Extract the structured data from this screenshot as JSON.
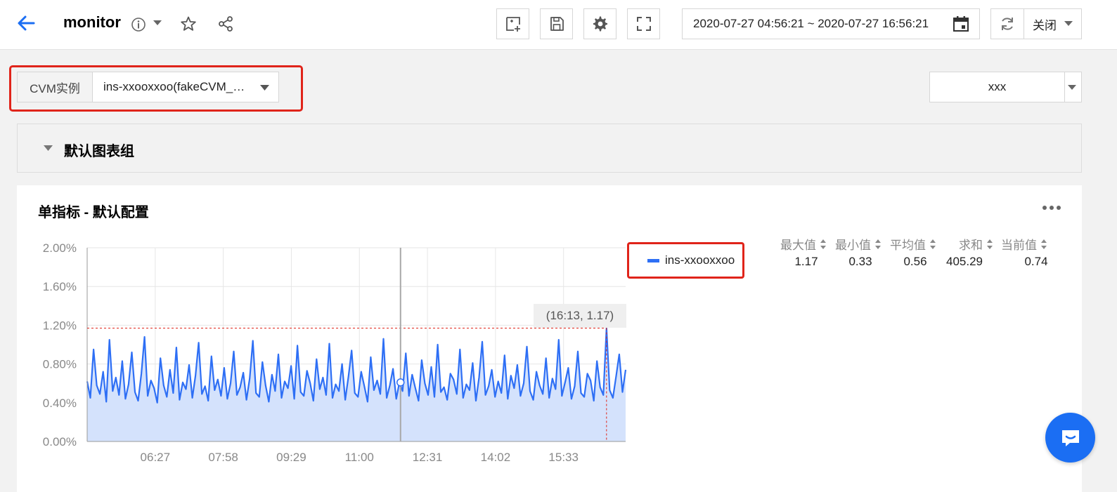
{
  "header": {
    "title": "monitor",
    "time_range": "2020-07-27 04:56:21 ~ 2020-07-27 16:56:21",
    "refresh_label": "关闭",
    "icons": [
      "back-arrow-icon",
      "info-icon",
      "chevron-down-icon",
      "star-icon",
      "share-icon",
      "add-chart-icon",
      "save-icon",
      "gear-icon",
      "fullscreen-icon",
      "calendar-icon",
      "refresh-icon"
    ]
  },
  "filter": {
    "label": "CVM实例",
    "value": "ins-xxooxxoo(fakeCVM_…",
    "right_select": "xxx"
  },
  "group": {
    "label": "默认图表组"
  },
  "panel": {
    "title": "单指标 - 默认配置",
    "tooltip": "(16:13, 1.17)",
    "legend": {
      "name": "ins-xxooxxoo",
      "color": "#2e6ff5"
    },
    "stats": {
      "headers": [
        "最大值",
        "最小值",
        "平均值",
        "求和",
        "当前值"
      ],
      "values": [
        "1.17",
        "0.33",
        "0.56",
        "405.29",
        "0.74"
      ]
    }
  },
  "chart_data": {
    "type": "area",
    "xlabel": "",
    "ylabel": "",
    "ylim": [
      0,
      2.0
    ],
    "yticks": [
      "0.00%",
      "0.40%",
      "0.80%",
      "1.20%",
      "1.60%",
      "2.00%"
    ],
    "xticks": [
      "06:27",
      "07:58",
      "09:29",
      "11:00",
      "12:31",
      "14:02",
      "15:33"
    ],
    "x_start": "04:56",
    "x_end": "16:56",
    "series": [
      {
        "name": "ins-xxooxxoo",
        "color": "#2e6ff5",
        "fill": "#d4e2fc",
        "values": [
          0.62,
          0.45,
          0.95,
          0.58,
          0.49,
          0.72,
          0.41,
          1.05,
          0.52,
          0.66,
          0.48,
          0.83,
          0.44,
          0.59,
          0.92,
          0.51,
          0.42,
          0.7,
          1.08,
          0.47,
          0.63,
          0.55,
          0.4,
          0.86,
          0.58,
          0.46,
          0.74,
          0.5,
          0.97,
          0.43,
          0.61,
          0.54,
          0.79,
          0.45,
          0.68,
          1.02,
          0.49,
          0.57,
          0.42,
          0.88,
          0.53,
          0.64,
          0.47,
          0.76,
          0.44,
          0.6,
          0.93,
          0.48,
          0.56,
          0.71,
          0.43,
          0.65,
          1.04,
          0.5,
          0.46,
          0.82,
          0.58,
          0.41,
          0.69,
          0.52,
          0.9,
          0.45,
          0.62,
          0.55,
          0.78,
          0.44,
          0.99,
          0.51,
          0.47,
          0.73,
          0.6,
          0.42,
          0.85,
          0.54,
          0.66,
          0.48,
          1.01,
          0.45,
          0.59,
          0.52,
          0.8,
          0.43,
          0.67,
          0.94,
          0.5,
          0.46,
          0.72,
          0.57,
          0.41,
          0.87,
          0.53,
          0.63,
          0.49,
          1.06,
          0.45,
          0.58,
          0.75,
          0.44,
          0.61,
          0.52,
          0.91,
          0.47,
          0.69,
          0.55,
          0.42,
          0.84,
          0.6,
          0.48,
          0.77,
          0.46,
          1.0,
          0.51,
          0.56,
          0.43,
          0.7,
          0.64,
          0.49,
          0.95,
          0.45,
          0.59,
          0.53,
          0.81,
          0.42,
          0.66,
          1.03,
          0.48,
          0.57,
          0.74,
          0.46,
          0.62,
          0.5,
          0.89,
          0.44,
          0.68,
          0.55,
          0.79,
          0.47,
          0.6,
          0.98,
          0.52,
          0.43,
          0.72,
          0.58,
          0.49,
          0.86,
          0.45,
          0.65,
          0.54,
          1.05,
          0.47,
          0.61,
          0.76,
          0.44,
          0.57,
          0.93,
          0.5,
          0.46,
          0.7,
          0.63,
          0.42,
          0.83,
          0.56,
          0.48,
          1.17,
          0.53,
          0.45,
          0.67,
          0.9,
          0.51,
          0.74
        ]
      }
    ],
    "max_marker": {
      "label": "(16:13, 1.17)",
      "value": 1.17
    },
    "crosshair_time": "11:55"
  }
}
